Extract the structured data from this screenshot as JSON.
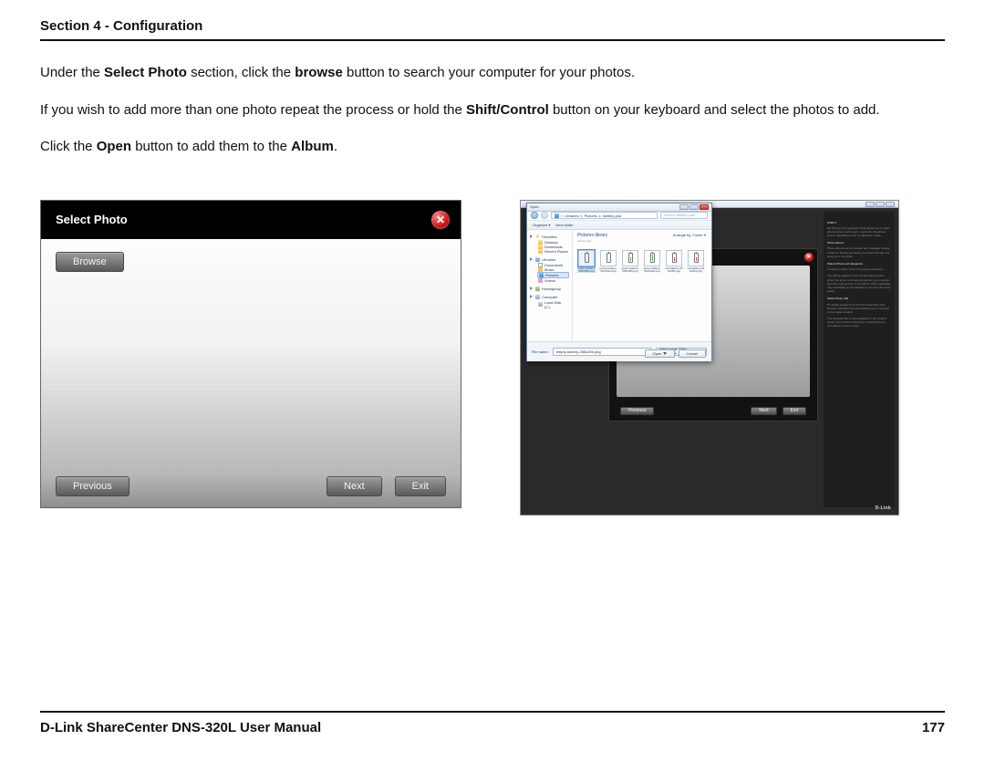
{
  "header": {
    "title": "Section 4 - Configuration"
  },
  "para1": {
    "a": "Under the ",
    "b": "Select Photo",
    "c": " section, click the ",
    "d": "browse",
    "e": " button to search your computer for your photos."
  },
  "para2": {
    "a": "If you wish to add more than one photo repeat the process or hold the ",
    "b": "Shift/Control",
    "c": " button on your keyboard and select the photos to add."
  },
  "para3": {
    "a": "Click the ",
    "b": "Open",
    "c": " button to add them to the ",
    "d": "Album",
    "e": "."
  },
  "fig1": {
    "title": "Select Photo",
    "close": "✕",
    "browse": "Browse",
    "previous": "Previous",
    "next": "Next",
    "exit": "Exit"
  },
  "fig2": {
    "darkpanel": {
      "previous": "Previous",
      "next": "Next",
      "exit": "Exit",
      "close": "✕"
    },
    "dialog": {
      "title": "Open",
      "addr": {
        "root": "Libraries",
        "l2": "Pictures",
        "l3": "battery-psd"
      },
      "search_placeholder": "Search battery-psd",
      "toolbar": {
        "organize": "Organize ▾",
        "newfolder": "New folder"
      },
      "lib": {
        "title": "Pictures library",
        "sub": "battery-psd"
      },
      "arrange": {
        "label": "Arrange by:",
        "value": "Folder ▾"
      },
      "nav": {
        "favorites": "Favorites",
        "desktop": "Desktop",
        "downloads": "Downloads",
        "recent": "Recent Places",
        "libraries": "Libraries",
        "documents": "Documents",
        "music": "Music",
        "pictures": "Pictures",
        "videos": "Videos",
        "homegroup": "Homegroup",
        "computer": "Computer",
        "localdisk": "Local Disk (C:)"
      },
      "thumbs": [
        {
          "name": "empty-battery-256x256.png",
          "color": "none",
          "level": "h0",
          "selected": true
        },
        {
          "name": "empty-battery-512x512.png",
          "color": "none",
          "level": "h0",
          "selected": false
        },
        {
          "name": "green-battery-256x256.png",
          "color": "g",
          "level": "h2",
          "selected": false
        },
        {
          "name": "green-battery-512x512.png",
          "color": "g",
          "level": "h3",
          "selected": false
        },
        {
          "name": "red-battery-256x256.png",
          "color": "r",
          "level": "h2",
          "selected": false
        },
        {
          "name": "red-battery-512x512.png",
          "color": "r",
          "level": "h2",
          "selected": false
        }
      ],
      "fname_label": "File name:",
      "fname_value": "empty-battery-256x256.png",
      "filter": "Web Image Files (.JPG;.GIF;.P…",
      "open": "Open",
      "cancel": "Cancel"
    },
    "side": {
      "h1": "STEP 1",
      "h2": "Photo albums",
      "h3": "Shared Photo and categories",
      "h4": "Select Photo (All)",
      "brand": "D-Link"
    }
  },
  "footer": {
    "left": "D-Link ShareCenter DNS-320L User Manual",
    "right": "177"
  }
}
